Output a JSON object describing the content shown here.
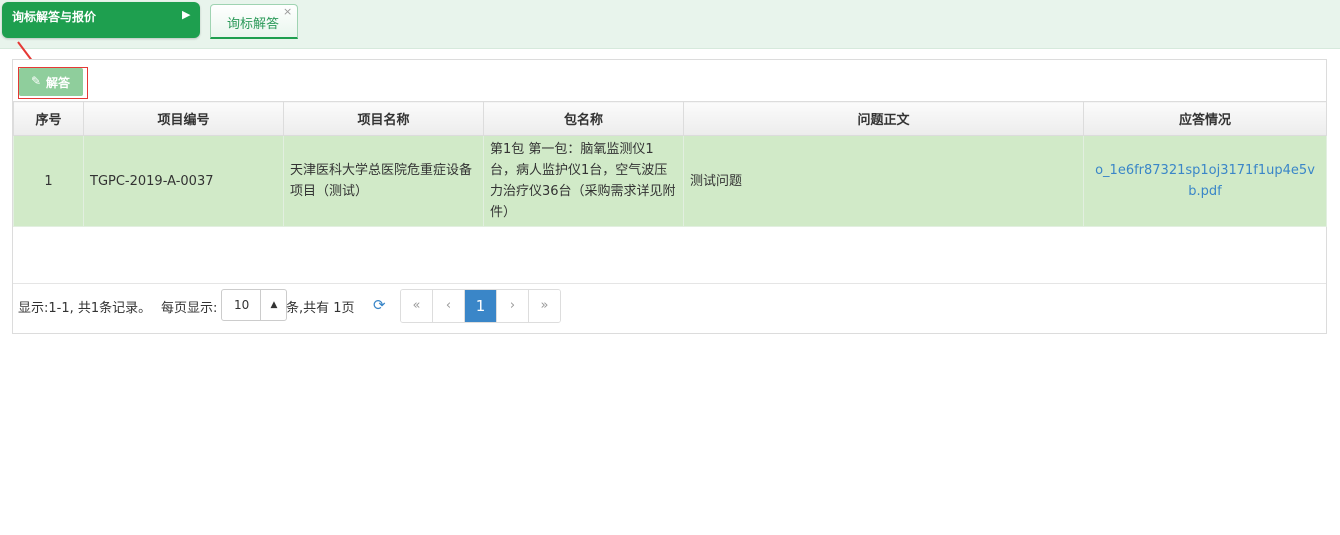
{
  "topbar": {
    "menu_label": "询标解答与报价",
    "menu_icon": "play-icon",
    "tab_label": "询标解答",
    "tab_close": "×"
  },
  "toolbar": {
    "answer_label": "解答",
    "answer_icon": "edit-icon"
  },
  "table": {
    "headers": [
      "序号",
      "项目编号",
      "项目名称",
      "包名称",
      "问题正文",
      "应答情况"
    ],
    "rows": [
      {
        "index": "1",
        "project_no": "TGPC-2019-A-0037",
        "project_name": "天津医科大学总医院危重症设备项目（测试）",
        "package_name": "第1包 第一包：脑氧监测仪1台，病人监护仪1台，空气波压力治疗仪36台（采购需求详见附件）",
        "question": "测试问题",
        "answer_file": "o_1e6fr87321sp1oj3171f1up4e5vb.pdf"
      }
    ]
  },
  "footer": {
    "info": "显示:1-1, 共1条记录。",
    "per_page_label": "每页显示:",
    "page_size": "10",
    "total_pages": "条,共有 1页",
    "pager": {
      "first": "«",
      "prev": "‹",
      "current": "1",
      "next": "›",
      "last": "»"
    }
  },
  "colors": {
    "accent_green": "#1e9f4f",
    "row_highlight": "#d1eac8",
    "link_blue": "#3a86c8",
    "annotation_red": "#e53935"
  }
}
